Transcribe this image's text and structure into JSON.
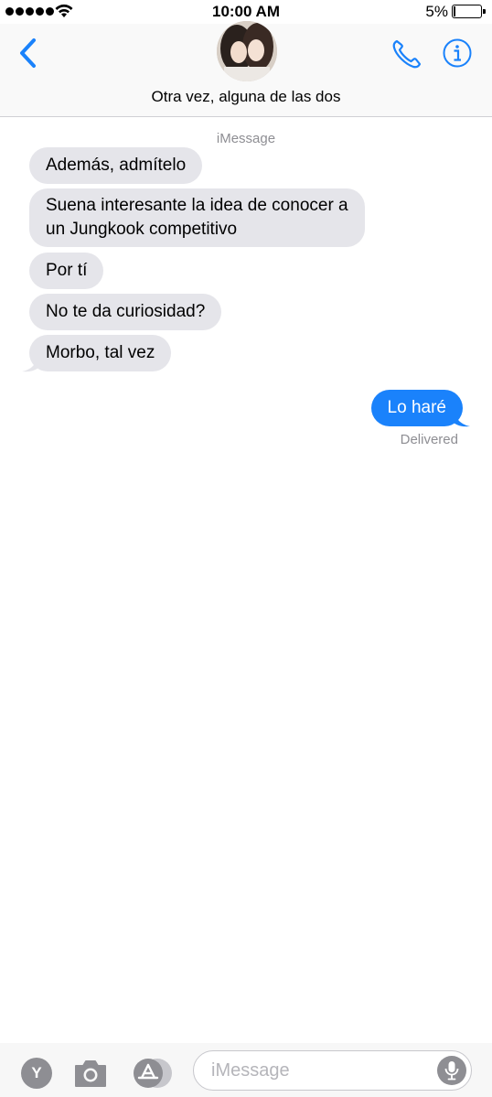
{
  "status_bar": {
    "time": "10:00 AM",
    "battery_percent": "5%",
    "signal_dots": 5
  },
  "header": {
    "contact_name": "Otra vez, alguna de las dos",
    "back_icon": "chevron-left-icon",
    "call_icon": "phone-icon",
    "info_icon": "info-icon",
    "accent_color": "#1a82fb"
  },
  "conversation": {
    "service_label": "iMessage",
    "incoming": [
      {
        "line1": "Además, admítelo",
        "line2": ""
      },
      {
        "line1": "Suena interesante la idea de conocer a",
        "line2": "un Jungkook competitivo"
      },
      {
        "line1": "Por tí",
        "line2": ""
      },
      {
        "line1": "No te da curiosidad?",
        "line2": ""
      },
      {
        "line1": "Morbo, tal vez",
        "line2": ""
      }
    ],
    "outgoing": [
      {
        "text": "Lo haré"
      }
    ],
    "delivered_label": "Delivered",
    "incoming_color": "#e5e5ea",
    "outgoing_color": "#1a82fb"
  },
  "composer": {
    "app_button_label": "Y",
    "camera_icon": "camera-icon",
    "appstore_icon": "app-store-icon",
    "placeholder": "iMessage",
    "mic_icon": "microphone-icon"
  }
}
